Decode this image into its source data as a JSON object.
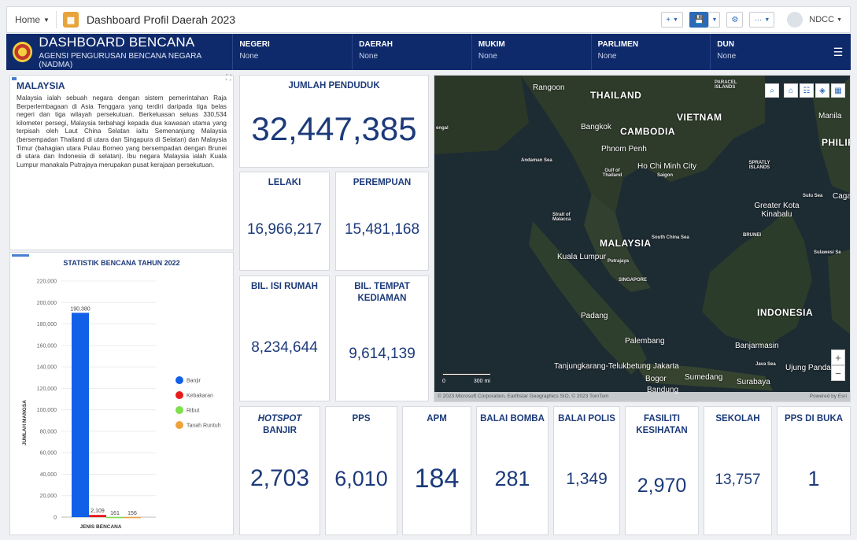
{
  "appbar": {
    "home_label": "Home",
    "title": "Dashboard Profil Daerah 2023",
    "add_label": "+",
    "user_label": "NDCC"
  },
  "header": {
    "title": "DASHBOARD BENCANA",
    "subtitle": "AGENSI PENGURUSAN BENCANA NEGARA (NADMA)",
    "filters": [
      {
        "label": "NEGERI",
        "value": "None"
      },
      {
        "label": "DAERAH",
        "value": "None"
      },
      {
        "label": "MUKIM",
        "value": "None"
      },
      {
        "label": "PARLIMEN",
        "value": "None"
      },
      {
        "label": "DUN",
        "value": "None"
      }
    ]
  },
  "about": {
    "title": "MALAYSIA",
    "text": "Malaysia ialah sebuah negara dengan sistem pemerintahan Raja Berperlembagaan di Asia Tenggara yang terdiri daripada tiga belas negeri dan tiga wilayah persekutuan. Berkeluasan seluas 330,534 kilometer persegi, Malaysia terbahagi kepada dua kawasan utama yang terpisah oleh Laut China Selatan iaitu Semenanjung Malaysia (bersempadan Thailand di utara dan Singapura di Selatan) dan Malaysia Timur (bahagian utara Pulau Borneo yang bersempadan dengan Brunei di utara dan Indonesia di selatan). Ibu negara Malaysia ialah Kuala Lumpur manakala Putrajaya merupakan pusat kerajaan persekutuan."
  },
  "kpis": {
    "jumlah_penduduk": {
      "label": "JUMLAH PENDUDUK",
      "value": "32,447,385"
    },
    "lelaki": {
      "label": "LELAKI",
      "value": "16,966,217"
    },
    "perempuan": {
      "label": "PEREMPUAN",
      "value": "15,481,168"
    },
    "isi_rumah": {
      "label": "BIL. ISI RUMAH",
      "value": "8,234,644"
    },
    "tempat_kediaman": {
      "label": "BIL. TEMPAT KEDIAMAN",
      "value": "9,614,139"
    }
  },
  "bottom_kpis": {
    "hotspot": {
      "label_em": "HOTSPOT",
      "label_rest": " BANJIR",
      "value": "2,703"
    },
    "pps": {
      "label": "PPS",
      "value": "6,010"
    },
    "apm": {
      "label": "APM",
      "value": "184"
    },
    "bomba": {
      "label": "BALAI BOMBA",
      "value": "281"
    },
    "polis": {
      "label": "BALAI POLIS",
      "value": "1,349"
    },
    "kesihatan": {
      "label": "FASILITI KESIHATAN",
      "value": "2,970"
    },
    "sekolah": {
      "label": "SEKOLAH",
      "value": "13,757"
    },
    "pps_buka": {
      "label": "PPS DI BUKA",
      "value": "1"
    }
  },
  "chart_data": {
    "type": "bar",
    "title": "STATISTIK BENCANA TAHUN 2022",
    "xlabel": "JENIS BENCANA",
    "ylabel": "JUMLAH MANGSA",
    "ylim": [
      0,
      220000
    ],
    "yticks": [
      "0",
      "20,000",
      "40,000",
      "60,000",
      "80,000",
      "100,000",
      "120,000",
      "140,000",
      "160,000",
      "180,000",
      "200,000",
      "220,000"
    ],
    "categories": [
      "Banjir",
      "Kebakaran",
      "Ribut",
      "Tanah Runtuh"
    ],
    "values": [
      190380,
      2109,
      161,
      156
    ],
    "value_labels": [
      "190,380",
      "2,109",
      "161",
      "156"
    ],
    "colors": [
      "#1160e8",
      "#e81b1b",
      "#7ee04a",
      "#f0a13a"
    ],
    "legend_position": "right"
  },
  "map": {
    "labels": [
      "Rangoon",
      "THAILAND",
      "VIETNAM",
      "Bangkok",
      "CAMBODIA",
      "Phnom Penh",
      "Ho Chi Minh City",
      "Saigon",
      "Gulf of Thailand",
      "Andaman Sea",
      "Strait of Malacca",
      "MALAYSIA",
      "South China Sea",
      "Kuala Lumpur",
      "Putrajaya",
      "SINGAPORE",
      "BRUNEI",
      "Greater Kota Kinabalu",
      "Sulu Sea",
      "PARACEL ISLANDS",
      "SPRATLY ISLANDS",
      "Manila",
      "PHILIP",
      "Sulawesi Se",
      "INDONESIA",
      "Padang",
      "Palembang",
      "Banjarmasin",
      "Java Sea",
      "Tanjungkarang-Telukbetung",
      "Jakarta",
      "Bogor",
      "Sumedang",
      "Surabaya",
      "Ujung Panda",
      "Bandung",
      "engal",
      "Caga"
    ],
    "scale_labels": [
      "0",
      "300 mi"
    ],
    "attribution": "© 2023 Microsoft Corporation, Earthstar Geographics SIO, © 2023 TomTom",
    "powered_by": "Powered by Esri"
  }
}
